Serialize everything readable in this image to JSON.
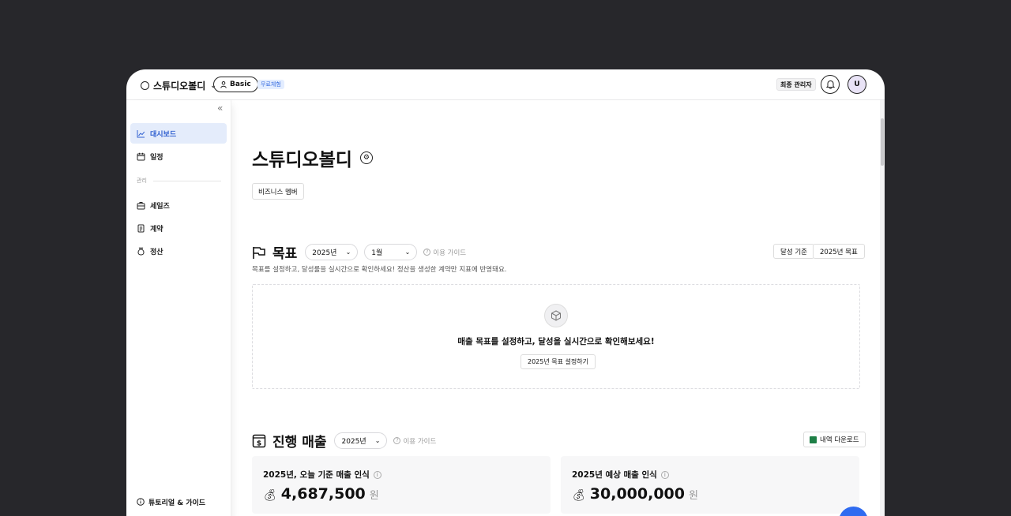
{
  "topbar": {
    "workspace_name": "스튜디오볼디",
    "plan_label": "Basic",
    "trial_badge": "무료체험",
    "role_label": "최종 관리자",
    "avatar_initial": "U"
  },
  "sidebar": {
    "items": [
      {
        "label": "대시보드",
        "icon": "chart-icon",
        "active": true
      },
      {
        "label": "일정",
        "icon": "calendar-icon"
      },
      {
        "label": "세일즈",
        "icon": "briefcase-icon"
      },
      {
        "label": "계약",
        "icon": "document-icon"
      },
      {
        "label": "정산",
        "icon": "money-bag-icon"
      }
    ],
    "section_label": "관리",
    "tutorial_label": "튜토리얼 & 가이드"
  },
  "main": {
    "title": "스튜디오볼디",
    "member_button": "비즈니스 멤버",
    "goal": {
      "title": "목표",
      "year_select": "2025년",
      "month_select": "1월",
      "guide": "이용 가이드",
      "btn_criteria": "달성 기준",
      "btn_year_goal": "2025년 목표",
      "description": "목표를 설정하고, 달성률을 실시간으로 확인하세요! 정산을 생성한 계약만 지표에 반영돼요.",
      "empty_text": "매출 목표를 설정하고, 달성을 실시간으로 확인해보세요!",
      "empty_button": "2025년 목표 설정하기"
    },
    "sales": {
      "title": "진행 매출",
      "year_select": "2025년",
      "guide": "이용 가이드",
      "download": "내역 다운로드",
      "cards": [
        {
          "label": "2025년, 오늘 기준 매출 인식",
          "value": "4,687,500",
          "unit": "원"
        },
        {
          "label": "2025년 예상 매출 인식",
          "value": "30,000,000",
          "unit": "원"
        }
      ]
    }
  },
  "colors": {
    "accent": "#2f5fd0",
    "active_bg": "#e4ecfb",
    "fab": "#2f6bf0"
  }
}
